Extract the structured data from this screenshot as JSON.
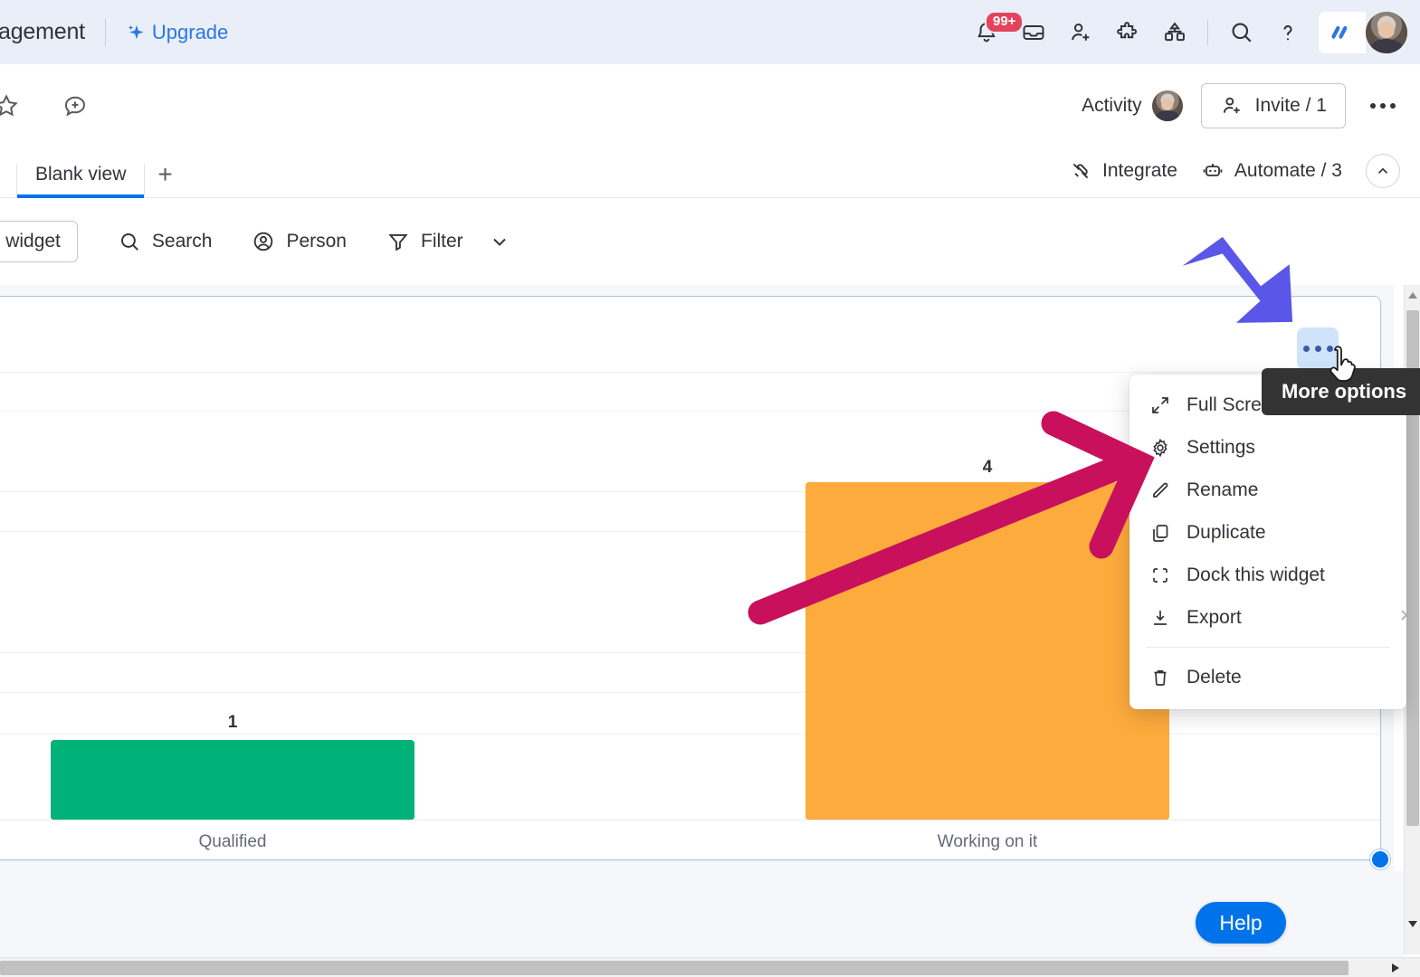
{
  "topbar": {
    "workspace_title": "agement",
    "upgrade_label": "Upgrade",
    "notification_badge": "99+",
    "icons": [
      {
        "name": "notifications-bell-icon",
        "label": "Notifications"
      },
      {
        "name": "inbox-icon",
        "label": "Inbox"
      },
      {
        "name": "invite-members-icon",
        "label": "Invite members"
      },
      {
        "name": "apps-puzzle-icon",
        "label": "Apps"
      },
      {
        "name": "workspaces-icon",
        "label": "Workspaces"
      },
      {
        "name": "search-icon",
        "label": "Search"
      },
      {
        "name": "help-question-icon",
        "label": "Help"
      },
      {
        "name": "monday-logo-icon",
        "label": "monday"
      }
    ]
  },
  "board_header": {
    "favorite_icon": "star-icon",
    "add_update_icon": "add-update-icon",
    "activity_label": "Activity",
    "invite_label": "Invite / 1",
    "more_label": "More"
  },
  "tabs": {
    "items": [
      {
        "label": "Blank view",
        "active": true
      }
    ],
    "add_tab_label": "+",
    "integrate_label": "Integrate",
    "automate_label": "Automate / 3",
    "collapse_label": "Collapse"
  },
  "widget_toolbar": {
    "add_widget_label": "dd widget",
    "search_label": "Search",
    "person_label": "Person",
    "filter_label": "Filter"
  },
  "widget": {
    "more_options_label": "More options",
    "tooltip_text": "More options"
  },
  "menu": {
    "items": [
      {
        "label": "Full Scree",
        "icon": "expand-fullscreen-icon",
        "has_submenu": false
      },
      {
        "label": "Settings",
        "icon": "gear-icon",
        "has_submenu": false
      },
      {
        "label": "Rename",
        "icon": "pencil-icon",
        "has_submenu": false
      },
      {
        "label": "Duplicate",
        "icon": "copy-icon",
        "has_submenu": false
      },
      {
        "label": "Dock this widget",
        "icon": "dock-icon",
        "has_submenu": false
      },
      {
        "label": "Export",
        "icon": "download-icon",
        "has_submenu": true
      }
    ],
    "delete_item": {
      "label": "Delete",
      "icon": "trash-icon"
    }
  },
  "help": {
    "label": "Help"
  },
  "colors": {
    "accent_blue": "#0073ea",
    "topbar_bg": "#e9eef8",
    "bar_green": "#00b277",
    "bar_orange": "#fdab3d",
    "arrow_purple": "#5a56e8",
    "arrow_crimson": "#c8105c",
    "badge_red": "#e2445c",
    "tooltip_bg": "#333333"
  },
  "annotations": [
    {
      "name": "purple-arrow-annotation",
      "color": "#5a56e8",
      "points_to": "more-options-button"
    },
    {
      "name": "crimson-arrow-annotation",
      "color": "#c8105c",
      "points_to": "widget-menu"
    }
  ],
  "chart_data": {
    "type": "bar",
    "title": "",
    "xlabel": "",
    "ylabel": "",
    "categories": [
      "Qualified",
      "Working on it"
    ],
    "values": [
      1,
      4
    ],
    "bar_colors": [
      "#00b277",
      "#fdab3d"
    ],
    "ylim": [
      0,
      5
    ],
    "grid": true,
    "legend": "none",
    "data_labels": [
      "1",
      "4"
    ]
  }
}
